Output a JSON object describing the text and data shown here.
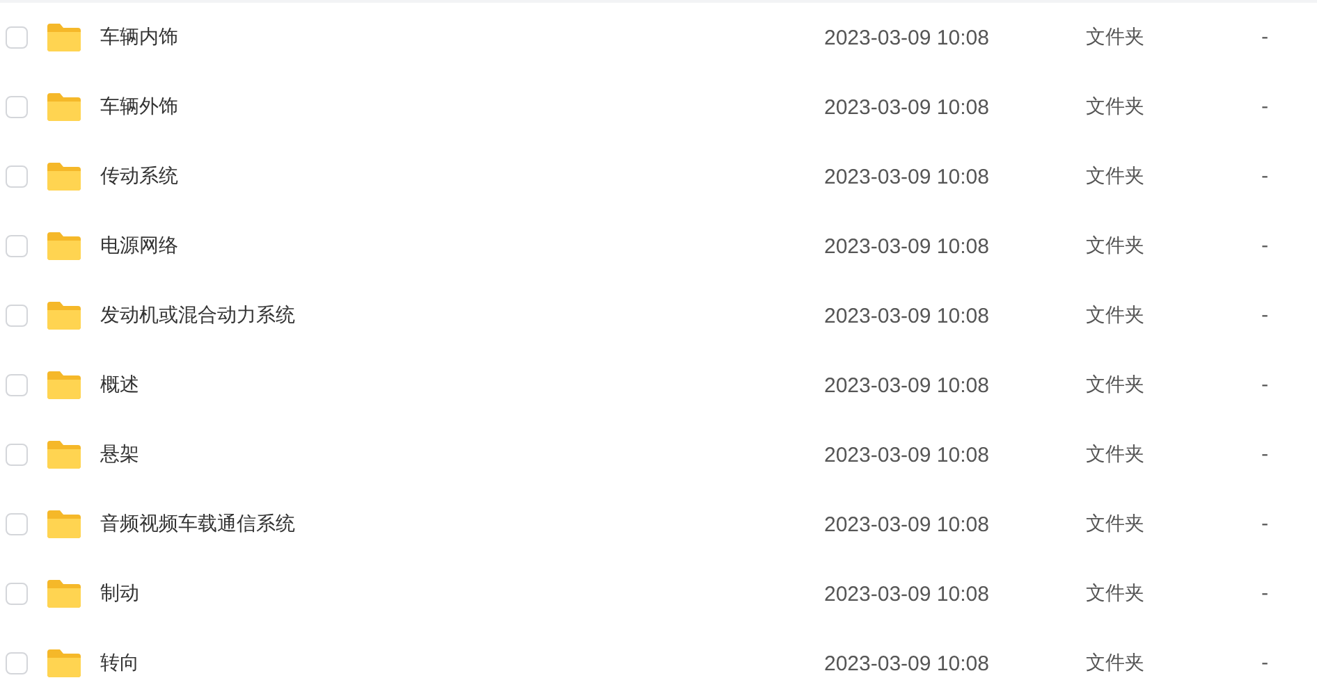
{
  "files": [
    {
      "name": "车辆内饰",
      "modified": "2023-03-09 10:08",
      "type": "文件夹",
      "size": "-",
      "checked": false
    },
    {
      "name": "车辆外饰",
      "modified": "2023-03-09 10:08",
      "type": "文件夹",
      "size": "-",
      "checked": false
    },
    {
      "name": "传动系统",
      "modified": "2023-03-09 10:08",
      "type": "文件夹",
      "size": "-",
      "checked": false
    },
    {
      "name": "电源网络",
      "modified": "2023-03-09 10:08",
      "type": "文件夹",
      "size": "-",
      "checked": false
    },
    {
      "name": "发动机或混合动力系统",
      "modified": "2023-03-09 10:08",
      "type": "文件夹",
      "size": "-",
      "checked": false
    },
    {
      "name": "概述",
      "modified": "2023-03-09 10:08",
      "type": "文件夹",
      "size": "-",
      "checked": false
    },
    {
      "name": "悬架",
      "modified": "2023-03-09 10:08",
      "type": "文件夹",
      "size": "-",
      "checked": false
    },
    {
      "name": "音频视频车载通信系统",
      "modified": "2023-03-09 10:08",
      "type": "文件夹",
      "size": "-",
      "checked": false
    },
    {
      "name": "制动",
      "modified": "2023-03-09 10:08",
      "type": "文件夹",
      "size": "-",
      "checked": false
    },
    {
      "name": "转向",
      "modified": "2023-03-09 10:08",
      "type": "文件夹",
      "size": "-",
      "checked": false
    }
  ]
}
